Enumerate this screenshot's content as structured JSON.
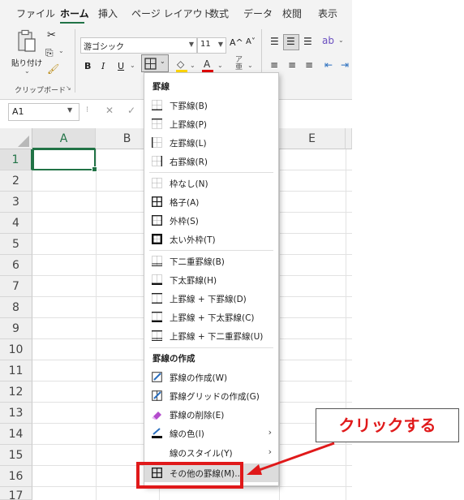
{
  "ribbon": {
    "tabs": [
      "ファイル",
      "ホーム",
      "挿入",
      "ページ レイアウト",
      "数式",
      "データ",
      "校閲",
      "表示"
    ],
    "clipboard": {
      "paste_label": "貼り付け",
      "group_label": "クリップボード"
    },
    "font": {
      "name": "游ゴシック",
      "size": "11",
      "grow": "A^",
      "shrink": "A˅",
      "bold": "B",
      "italic": "I",
      "underline": "U"
    }
  },
  "formula_bar": {
    "name_box": "A1",
    "cancel": "✕",
    "confirm": "✓"
  },
  "sheet": {
    "columns": [
      "A",
      "B",
      "E"
    ],
    "rows": [
      "1",
      "2",
      "3",
      "4",
      "5",
      "6",
      "7",
      "8",
      "9",
      "10",
      "11",
      "12",
      "13",
      "14",
      "15",
      "16",
      "17"
    ]
  },
  "border_menu": {
    "section_borders": "罫線",
    "section_draw": "罫線の作成",
    "items": [
      {
        "label": "下罫線(B)",
        "icon": "border-bottom-icon"
      },
      {
        "label": "上罫線(P)",
        "icon": "border-top-icon"
      },
      {
        "label": "左罫線(L)",
        "icon": "border-left-icon"
      },
      {
        "label": "右罫線(R)",
        "icon": "border-right-icon"
      },
      {
        "label": "枠なし(N)",
        "icon": "no-border-icon"
      },
      {
        "label": "格子(A)",
        "icon": "all-borders-icon"
      },
      {
        "label": "外枠(S)",
        "icon": "outside-borders-icon"
      },
      {
        "label": "太い外枠(T)",
        "icon": "thick-outside-border-icon"
      },
      {
        "label": "下二重罫線(B)",
        "icon": "double-bottom-border-icon"
      },
      {
        "label": "下太罫線(H)",
        "icon": "thick-bottom-border-icon"
      },
      {
        "label": "上罫線 + 下罫線(D)",
        "icon": "top-bottom-border-icon"
      },
      {
        "label": "上罫線 + 下太罫線(C)",
        "icon": "top-thick-bottom-border-icon"
      },
      {
        "label": "上罫線 + 下二重罫線(U)",
        "icon": "top-double-bottom-border-icon"
      },
      {
        "label": "罫線の作成(W)",
        "icon": "draw-border-icon"
      },
      {
        "label": "罫線グリッドの作成(G)",
        "icon": "draw-border-grid-icon"
      },
      {
        "label": "罫線の削除(E)",
        "icon": "erase-border-icon"
      },
      {
        "label": "線の色(I)",
        "icon": "line-color-icon"
      },
      {
        "label": "線のスタイル(Y)",
        "icon": "line-style-icon"
      },
      {
        "label": "その他の罫線(M)...",
        "icon": "more-borders-icon"
      }
    ]
  },
  "annotation": {
    "callout": "クリックする",
    "color": "#e0191a"
  }
}
